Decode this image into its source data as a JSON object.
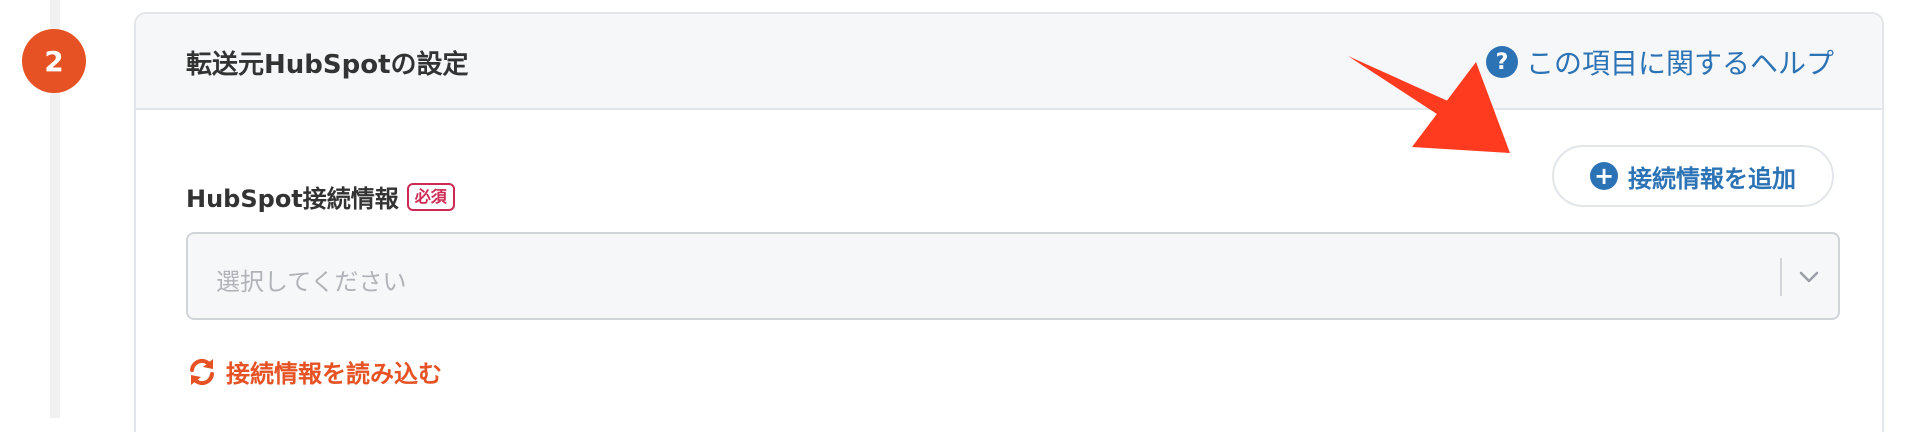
{
  "step": {
    "number": "2"
  },
  "section": {
    "title": "転送元HubSpotの設定",
    "help_link_label": "この項目に関するヘルプ",
    "help_icon_glyph": "?"
  },
  "connection_field": {
    "label": "HubSpot接続情報",
    "required_badge": "必須",
    "add_button_label": "接続情報を追加",
    "add_button_icon_glyph": "+",
    "select_placeholder": "選択してください",
    "reload_link_label": "接続情報を読み込む"
  },
  "icons": {
    "help": "question-circle-icon",
    "add": "plus-circle-icon",
    "dropdown": "chevron-down-icon",
    "reload": "refresh-icon",
    "annotation": "red-arrow-annotation"
  },
  "colors": {
    "step_badge": "#e65223",
    "link_blue": "#2c73b5",
    "required_red": "#cc2a54",
    "reload_orange": "#e65223",
    "annotation_arrow": "#ff3b1f"
  }
}
